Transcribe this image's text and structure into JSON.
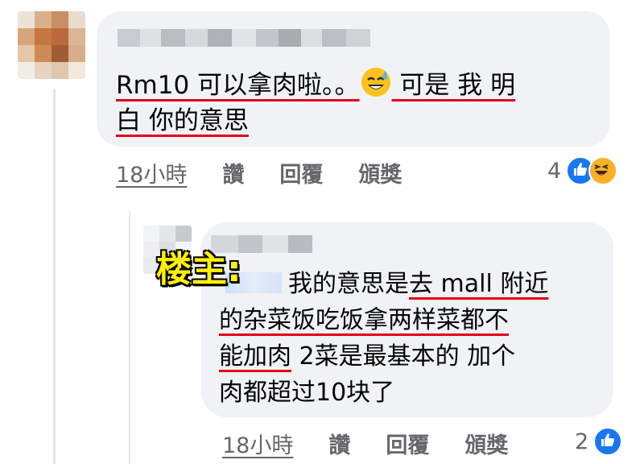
{
  "comment1": {
    "text_line1_part1": "Rm10 可以拿肉啦。。",
    "text_line1_part2": " 可是 我 明",
    "text_line2": "白 你的意思",
    "time": "18小時",
    "like": "讚",
    "reply": "回覆",
    "award": "頒獎",
    "reaction_count": "4",
    "reactions": [
      "like-icon",
      "haha-icon"
    ]
  },
  "reply1": {
    "tag_label": "楼主:",
    "line1_pre": "我的意思是",
    "line1_ul": "去 mall 附近",
    "line2_ul": "的杂菜饭吃饭拿两样菜都不",
    "line3_ul": "能加肉",
    "line3_post": " 2菜是最基本的 加个",
    "line4": "肉都超过10块了",
    "time": "18小時",
    "like": "讚",
    "reply": "回覆",
    "award": "頒獎",
    "reaction_count": "2",
    "reactions": [
      "like-icon"
    ]
  },
  "colors": {
    "bubble": "#f0f2f5",
    "underline": "#e0001a",
    "like": "#1877f2",
    "haha": "#f7b125",
    "tag": "#fff200",
    "meta": "#65676b"
  }
}
